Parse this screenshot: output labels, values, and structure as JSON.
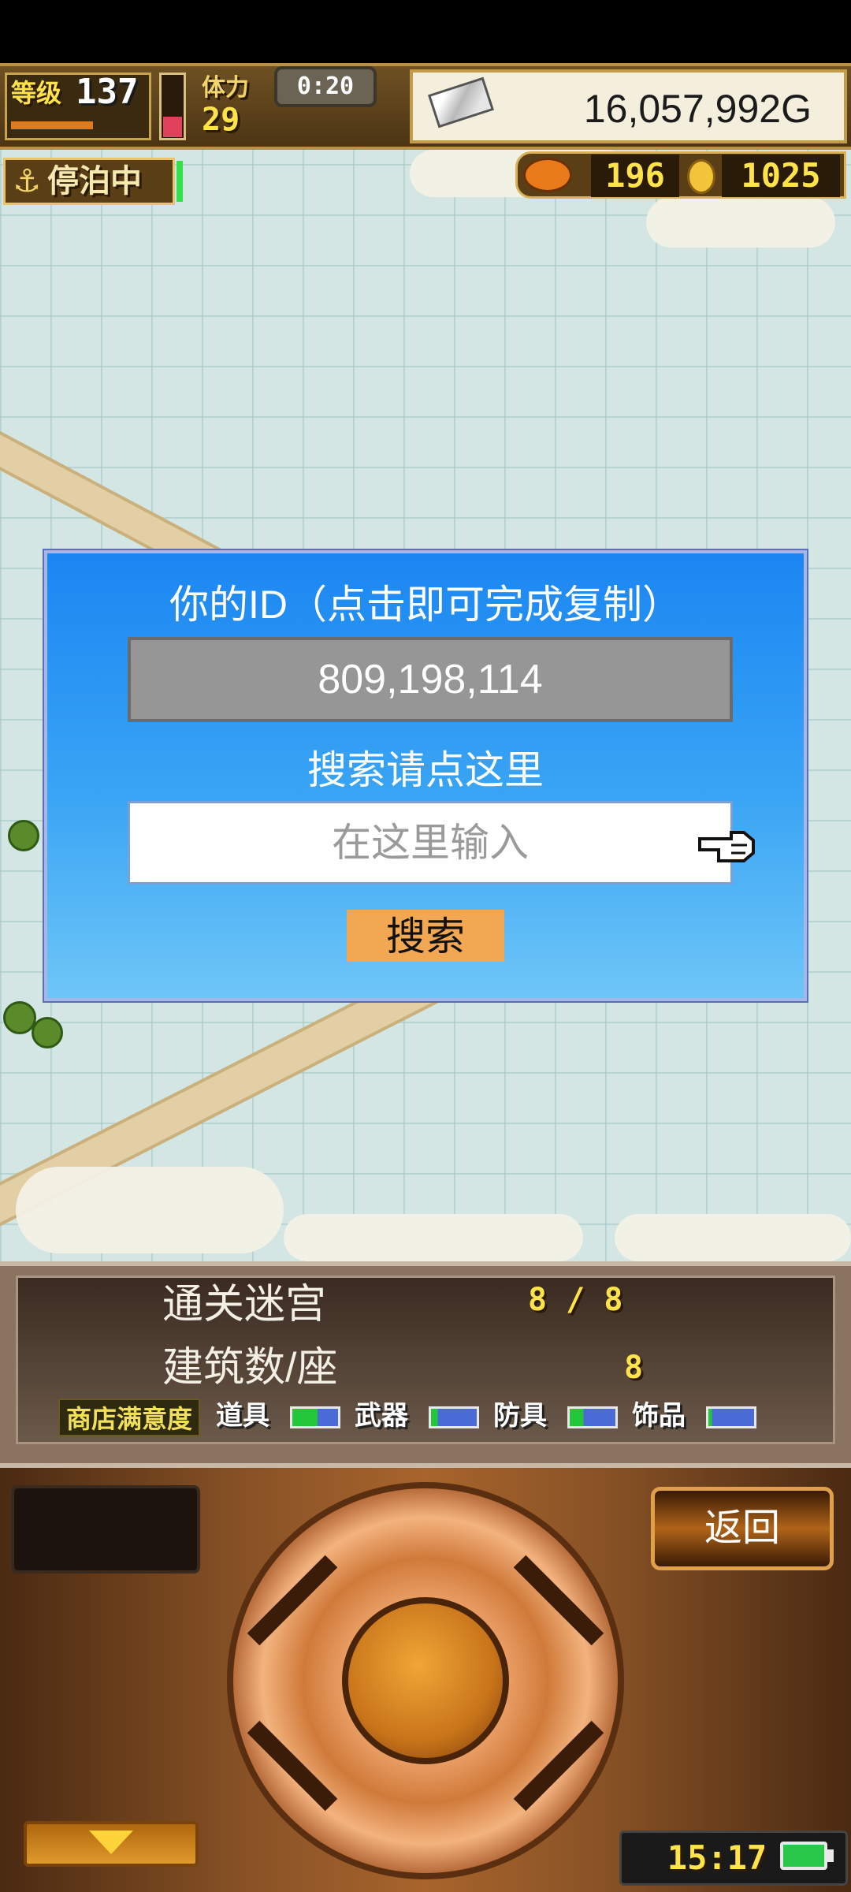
{
  "status_bar": {
    "level_label": "等级",
    "level_value": "137",
    "stamina_label": "体力",
    "stamina_value": "29",
    "timer": "0:20",
    "gold": "16,057,992G",
    "docked_label": "停泊中",
    "resource_a": "196",
    "resource_b": "1025"
  },
  "dialog": {
    "id_title": "你的ID（点击即可完成复制）",
    "id_value": "809,198,114",
    "search_title": "搜索请点这里",
    "search_placeholder": "在这里输入",
    "search_button": "搜索"
  },
  "info_panel": {
    "dungeon_label": "通关迷宫",
    "dungeon_value": "8 / 8",
    "buildings_label": "建筑数/座",
    "buildings_value": "8",
    "satisfaction_label": "商店满意度",
    "categories": [
      {
        "label": "道具",
        "bar_color": "#22c83a"
      },
      {
        "label": "武器",
        "bar_color": "#4a6ad8"
      },
      {
        "label": "防具",
        "bar_color": "#4a6ad8"
      },
      {
        "label": "饰品",
        "bar_color": "#4a6ad8"
      }
    ]
  },
  "console": {
    "back_button": "返回",
    "clock": "15:17"
  },
  "colors": {
    "dialog_top": "#1b86f2",
    "dialog_bottom": "#6ec6f7",
    "search_button": "#f2a852",
    "gold_text": "#ffe34a"
  }
}
